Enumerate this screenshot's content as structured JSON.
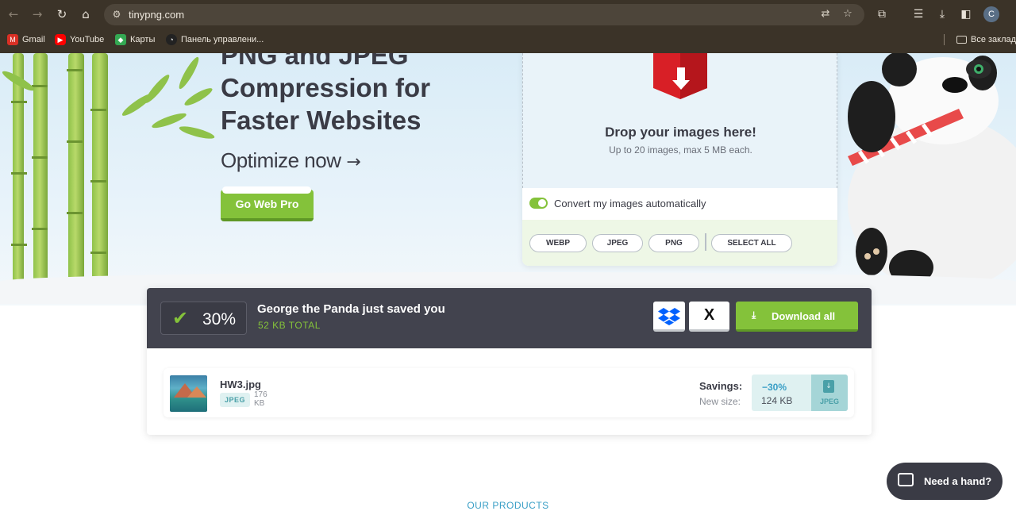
{
  "browser": {
    "url": "tinypng.com",
    "profile_initial": "C",
    "bookmarks": [
      {
        "label": "Gmail",
        "icon": "gmail-icon",
        "color": "#d93025"
      },
      {
        "label": "YouTube",
        "icon": "youtube-icon",
        "color": "#ff0000"
      },
      {
        "label": "Карты",
        "icon": "maps-icon",
        "color": "#34a853"
      },
      {
        "label": "Панель управлени...",
        "icon": "dashboard-icon",
        "color": "#222222"
      }
    ],
    "all_bookmarks": "Все закладк"
  },
  "hero": {
    "headline_lines": [
      "PNG and JPEG",
      "Compression for",
      "Faster Websites"
    ],
    "optimize": "Optimize now",
    "optimize_arrow": "→",
    "go_web_pro": "Go Web Pro"
  },
  "upload": {
    "title": "Drop your images here!",
    "subtitle": "Up to 20 images, max 5 MB each.",
    "convert_label": "Convert my images automatically",
    "convert_enabled": true,
    "formats": [
      "WEBP",
      "JPEG",
      "PNG"
    ],
    "select_all": "SELECT ALL"
  },
  "result": {
    "percent": "30%",
    "title": "George the Panda just saved you",
    "total": "52 KB TOTAL",
    "share_x": "X",
    "download_all": "Download all",
    "files": [
      {
        "name": "HW3.jpg",
        "type": "JPEG",
        "size_value": "176",
        "size_unit": "KB",
        "savings_label": "Savings:",
        "new_size_label": "New size:",
        "savings": "−30%",
        "new_size": "124 KB",
        "download_format": "JPEG"
      }
    ]
  },
  "footer": {
    "our_products": "OUR PRODUCTS"
  },
  "help": {
    "label": "Need a hand?"
  },
  "colors": {
    "accent_green": "#84c23a",
    "dark_panel": "#42434e",
    "link_blue": "#3a9fc6"
  }
}
